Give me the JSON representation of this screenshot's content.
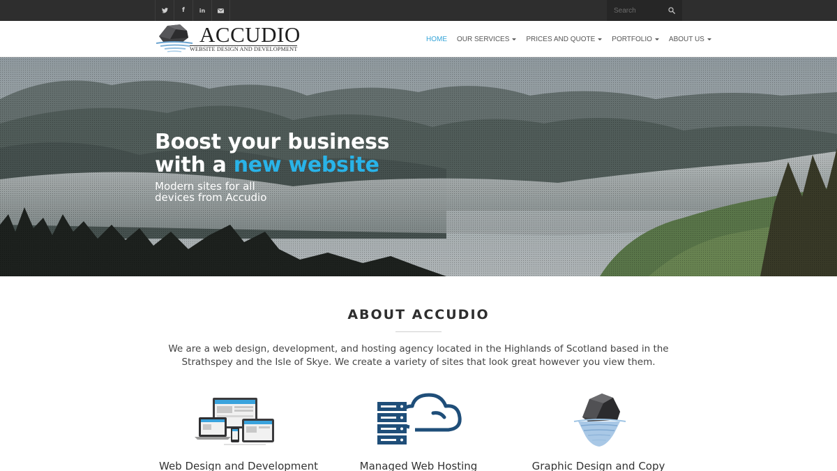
{
  "topbar": {
    "social": [
      {
        "name": "twitter-icon",
        "glyph": "🐦"
      },
      {
        "name": "facebook-icon",
        "glyph": "f"
      },
      {
        "name": "linkedin-icon",
        "glyph": "in"
      },
      {
        "name": "email-icon",
        "glyph": "✉"
      }
    ],
    "search_placeholder": "Search"
  },
  "header": {
    "logo_name": "ACCUDIO",
    "logo_tagline": "WEBSITE DESIGN AND DEVELOPMENT",
    "nav": [
      {
        "label": "HOME",
        "active": true,
        "dropdown": false
      },
      {
        "label": "OUR SERVICES",
        "active": false,
        "dropdown": true
      },
      {
        "label": "PRICES AND QUOTE",
        "active": false,
        "dropdown": true
      },
      {
        "label": "PORTFOLIO",
        "active": false,
        "dropdown": true
      },
      {
        "label": "ABOUT US",
        "active": false,
        "dropdown": true
      }
    ]
  },
  "hero": {
    "title_line1": "Boost your business",
    "title_line2_prefix": "with a ",
    "title_line2_accent": "new website",
    "subtitle_line1": "Modern sites for all",
    "subtitle_line2": "devices from Accudio"
  },
  "about": {
    "title": "ABOUT ACCUDIO",
    "text": "We are a web design, development, and hosting agency located in the Highlands of Scotland based in the Strathspey and the Isle of Skye. We create a variety of sites that look great however you view them.",
    "services": [
      {
        "label": "Web Design and Development",
        "icon": "responsive-devices-icon"
      },
      {
        "label": "Managed Web Hosting",
        "icon": "server-cloud-icon"
      },
      {
        "label": "Graphic Design and Copy",
        "icon": "rock-reflection-icon"
      }
    ]
  },
  "colors": {
    "accent": "#29b3e8",
    "nav_active": "#35a4d8",
    "topbar": "#2e2e2e",
    "icon_navy": "#1f4e79"
  }
}
